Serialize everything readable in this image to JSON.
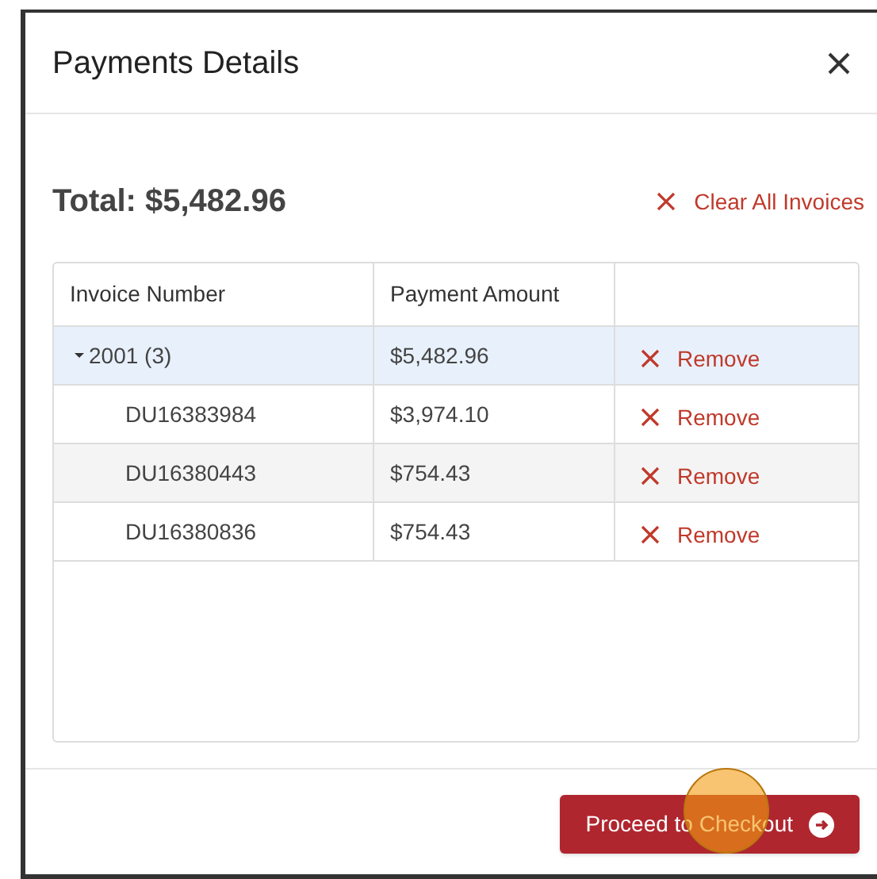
{
  "dialog": {
    "title": "Payments Details"
  },
  "total": "Total: $5,482.96",
  "clear_all": "Clear All Invoices",
  "table": {
    "columns": [
      "Invoice Number",
      "Payment Amount"
    ],
    "rows": [
      {
        "invoice": "2001 (3)",
        "amount": "$5,482.96",
        "action": "Remove",
        "expanded": true,
        "selected": true,
        "children": [
          {
            "invoice": "DU16383984",
            "amount": "$3,974.10",
            "action": "Remove",
            "selected": false
          },
          {
            "invoice": "DU16380443",
            "amount": "$754.43",
            "action": "Remove",
            "selected": false
          },
          {
            "invoice": "DU16380836",
            "amount": "$754.43",
            "action": "Remove",
            "selected": false
          }
        ]
      }
    ]
  },
  "checkout_button": "Proceed to Checkout"
}
